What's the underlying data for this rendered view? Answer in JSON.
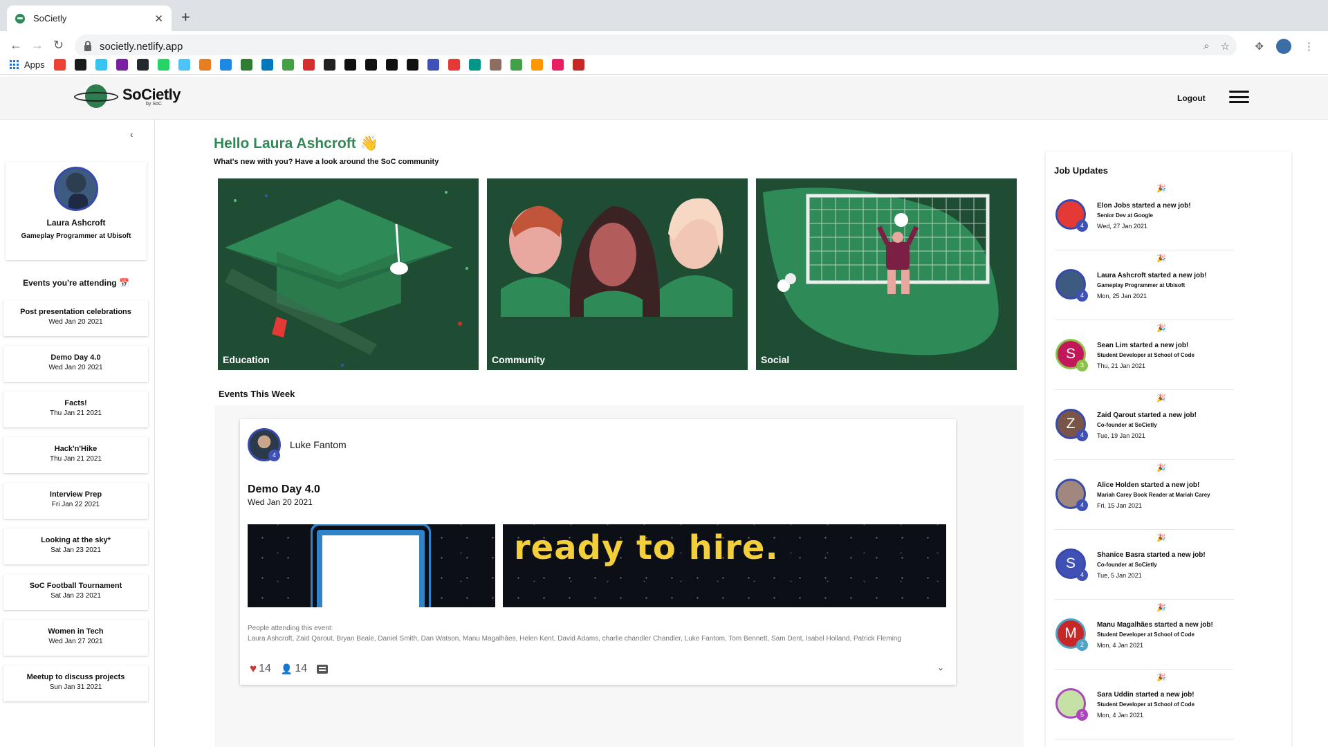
{
  "browser": {
    "tab_title": "SoCietly",
    "tab_close": "✕",
    "new_tab": "+",
    "url": "societly.netlify.app",
    "bookmarks_apps_label": "Apps",
    "bookmark_colors": [
      "#ea4335",
      "#1b1b1b",
      "#36c5f0",
      "#7b1fa2",
      "#24292e",
      "#25d366",
      "#4fc3f7",
      "#e67e22",
      "#1e88e5",
      "#2e7d32",
      "#0277bd",
      "#43a047",
      "#d32f2f",
      "#222",
      "#111",
      "#111",
      "#111",
      "#111",
      "#3f51b5",
      "#e53935",
      "#009688",
      "#8d6e63",
      "#43a047",
      "#ff9800",
      "#e91e63",
      "#c62828"
    ]
  },
  "header": {
    "logo_name": "SoCietly",
    "logo_by": "by SoC",
    "logout": "Logout"
  },
  "sidebar": {
    "collapse_icon": "‹",
    "profile": {
      "name": "Laura Ashcroft",
      "role": "Gameplay Programmer at Ubisoft"
    },
    "events_heading": "Events you're attending 📅",
    "events": [
      {
        "name": "Post presentation celebrations",
        "date": "Wed Jan 20 2021"
      },
      {
        "name": "Demo Day 4.0",
        "date": "Wed Jan 20 2021"
      },
      {
        "name": "Facts!",
        "date": "Thu Jan 21 2021"
      },
      {
        "name": "Hack'n'Hike",
        "date": "Thu Jan 21 2021"
      },
      {
        "name": "Interview Prep",
        "date": "Fri Jan 22 2021"
      },
      {
        "name": "Looking at the sky*",
        "date": "Sat Jan 23 2021"
      },
      {
        "name": "SoC Football Tournament",
        "date": "Sat Jan 23 2021"
      },
      {
        "name": "Women in Tech",
        "date": "Wed Jan 27 2021"
      },
      {
        "name": "Meetup to discuss projects",
        "date": "Sun Jan 31 2021"
      }
    ]
  },
  "main": {
    "greeting": "Hello Laura Ashcroft 👋",
    "subtitle": "What's new with you? Have a look around the SoC community",
    "tiles": [
      {
        "label": "Education"
      },
      {
        "label": "Community"
      },
      {
        "label": "Social"
      }
    ],
    "events_week_heading": "Events This Week",
    "post": {
      "author": "Luke Fantom",
      "author_badge": "4",
      "title": "Demo Day 4.0",
      "date": "Wed Jan 20 2021",
      "banner_text": "ready to hire.",
      "attending_label": "People attending this event:",
      "attending_list": "Laura Ashcroft, Zaid Qarout, Bryan Beale, Daniel Smith, Dan Watson, Manu Magalhães, Helen Kent, David Adams, charlie chandler Chandler, Luke Fantom, Tom Bennett, Sam Dent, Isabel Holland, Patrick Fleming",
      "likes": "14",
      "attendees_count": "14",
      "expand_icon": "⌄"
    }
  },
  "jobs": {
    "title": "Job Updates",
    "party_emoji": "🎉",
    "items": [
      {
        "title": "Elon Jobs started a new job!",
        "role": "Senior Dev at Google",
        "date": "Wed, 27 Jan 2021",
        "initial": "",
        "badge": "4",
        "avatar_color": "#e53935",
        "ring_color": "#3949ab",
        "badge_color": "#3f51b5"
      },
      {
        "title": "Laura Ashcroft started a new job!",
        "role": "Gameplay Programmer at Ubisoft",
        "date": "Mon, 25 Jan 2021",
        "initial": "",
        "badge": "4",
        "avatar_color": "#3d5a80",
        "ring_color": "#3949ab",
        "badge_color": "#3f51b5"
      },
      {
        "title": "Sean Lim started a new job!",
        "role": "Student Developer at School of Code",
        "date": "Thu, 21 Jan 2021",
        "initial": "S",
        "badge": "3",
        "avatar_color": "#c2185b",
        "ring_color": "#8bc34a",
        "badge_color": "#8bc34a"
      },
      {
        "title": "Zaid Qarout started a new job!",
        "role": "Co-founder at SoCietly",
        "date": "Tue, 19 Jan 2021",
        "initial": "Z",
        "badge": "4",
        "avatar_color": "#795548",
        "ring_color": "#3949ab",
        "badge_color": "#3f51b5"
      },
      {
        "title": "Alice Holden started a new job!",
        "role": "Mariah Carey Book Reader at Mariah Carey",
        "date": "Fri, 15 Jan 2021",
        "initial": "",
        "badge": "4",
        "avatar_color": "#a1887f",
        "ring_color": "#3949ab",
        "badge_color": "#3f51b5"
      },
      {
        "title": "Shanice Basra started a new job!",
        "role": "Co-founder at SoCietly",
        "date": "Tue, 5 Jan 2021",
        "initial": "S",
        "badge": "4",
        "avatar_color": "#3f51b5",
        "ring_color": "#3949ab",
        "badge_color": "#3f51b5"
      },
      {
        "title": "Manu Magalhães started a new job!",
        "role": "Student Developer at School of Code",
        "date": "Mon, 4 Jan 2021",
        "initial": "M",
        "badge": "2",
        "avatar_color": "#c62828",
        "ring_color": "#4fa3c7",
        "badge_color": "#4fa3c7"
      },
      {
        "title": "Sara Uddin started a new job!",
        "role": "Student Developer at School of Code",
        "date": "Mon, 4 Jan 2021",
        "initial": "",
        "badge": "5",
        "avatar_color": "#c5e1a5",
        "ring_color": "#ab47bc",
        "badge_color": "#ab47bc"
      }
    ]
  }
}
